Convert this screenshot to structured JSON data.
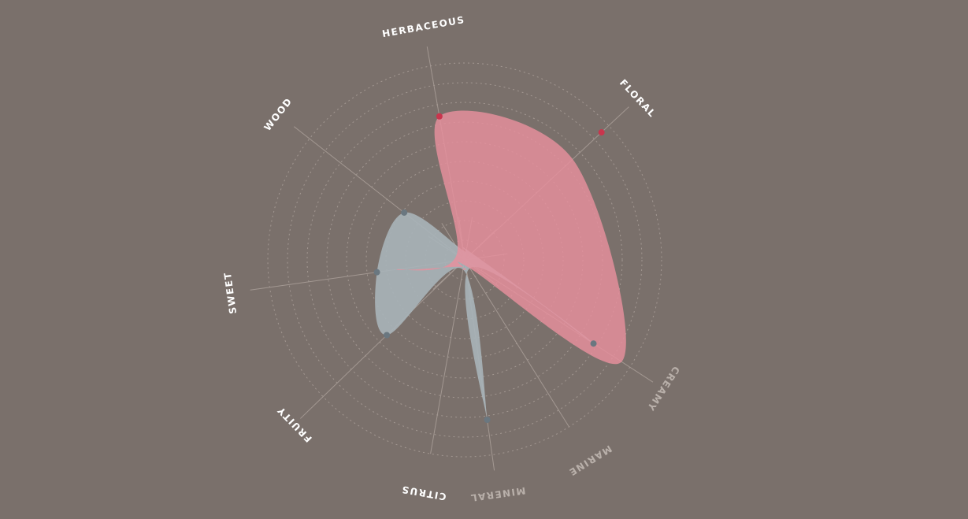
{
  "chart_data": {
    "type": "radar",
    "title": "",
    "axes": [
      {
        "label": "HERBACEOUS",
        "color": "#ffffff"
      },
      {
        "label": "FLORAL",
        "color": "#ffffff"
      },
      {
        "label": "CREAMY",
        "color": "#b9b0aa"
      },
      {
        "label": "MARINE",
        "color": "#b9b0aa"
      },
      {
        "label": "MINERAL",
        "color": "#b9b0aa"
      },
      {
        "label": "CITRUS",
        "color": "#ffffff"
      },
      {
        "label": "FRUITY",
        "color": "#ffffff"
      },
      {
        "label": "SWEET",
        "color": "#ffffff"
      },
      {
        "label": "WOOD",
        "color": "#ffffff"
      }
    ],
    "rings": 10,
    "series": [
      {
        "values": [
          0.74,
          0.75,
          0.95,
          0.05,
          0.05,
          0.05,
          0.05,
          0.35,
          0.05
        ],
        "markers": [
          0,
          1
        ],
        "marker_values": [
          0.74,
          0.95
        ],
        "color": "#e8909d",
        "marker_color": "#c9354d"
      },
      {
        "values": [
          0.05,
          0.05,
          0.78,
          0.05,
          0.82,
          0.05,
          0.55,
          0.45,
          0.39
        ],
        "color": "#a8b4b9",
        "marker_color": "#6a7780"
      }
    ],
    "colors": {
      "ring": "#a39892",
      "spoke": "#a39892",
      "background": "#7a706b"
    }
  }
}
